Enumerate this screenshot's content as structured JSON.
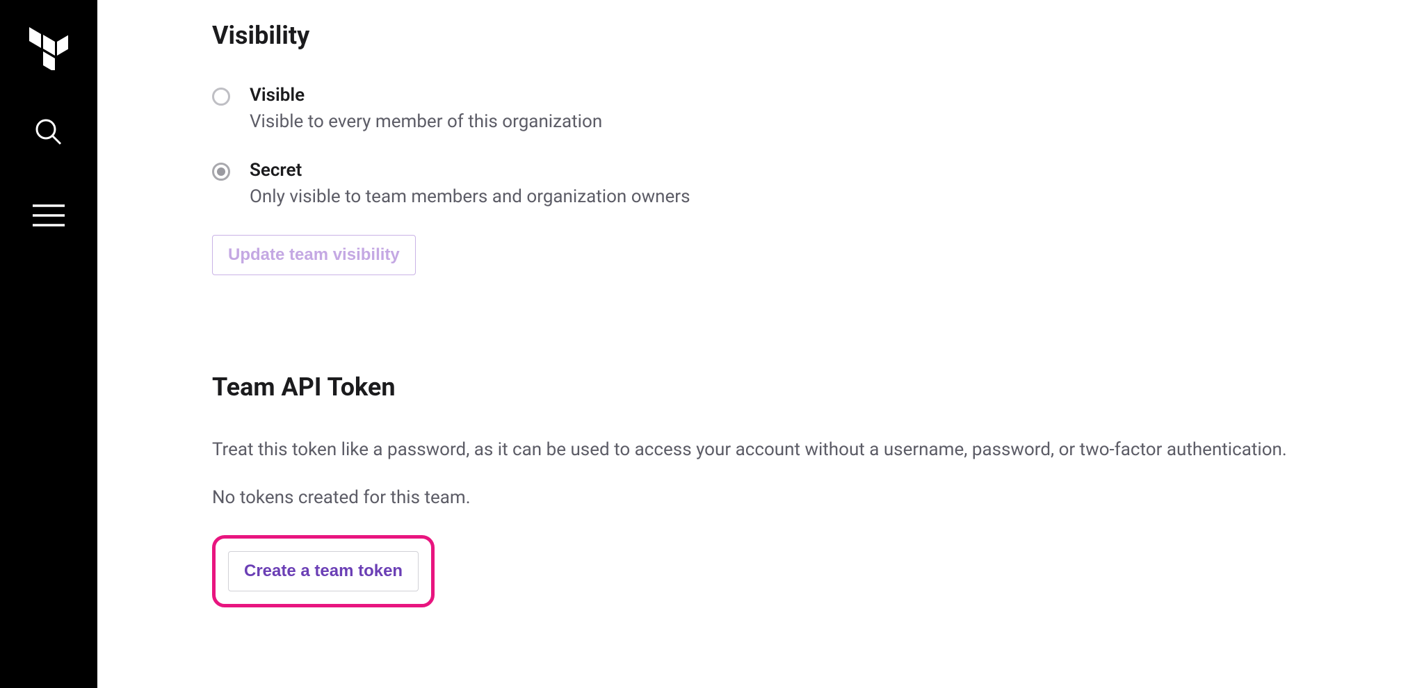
{
  "sidebar": {
    "logo_name": "terraform-logo",
    "search_name": "search-icon",
    "menu_name": "menu-icon"
  },
  "visibility": {
    "heading": "Visibility",
    "options": [
      {
        "label": "Visible",
        "description": "Visible to every member of this organization",
        "selected": false
      },
      {
        "label": "Secret",
        "description": "Only visible to team members and organization owners",
        "selected": true
      }
    ],
    "button_label": "Update team visibility"
  },
  "token": {
    "heading": "Team API Token",
    "description": "Treat this token like a password, as it can be used to access your account without a username, password, or two-factor authentication.",
    "status_text": "No tokens created for this team.",
    "button_label": "Create a team token"
  }
}
